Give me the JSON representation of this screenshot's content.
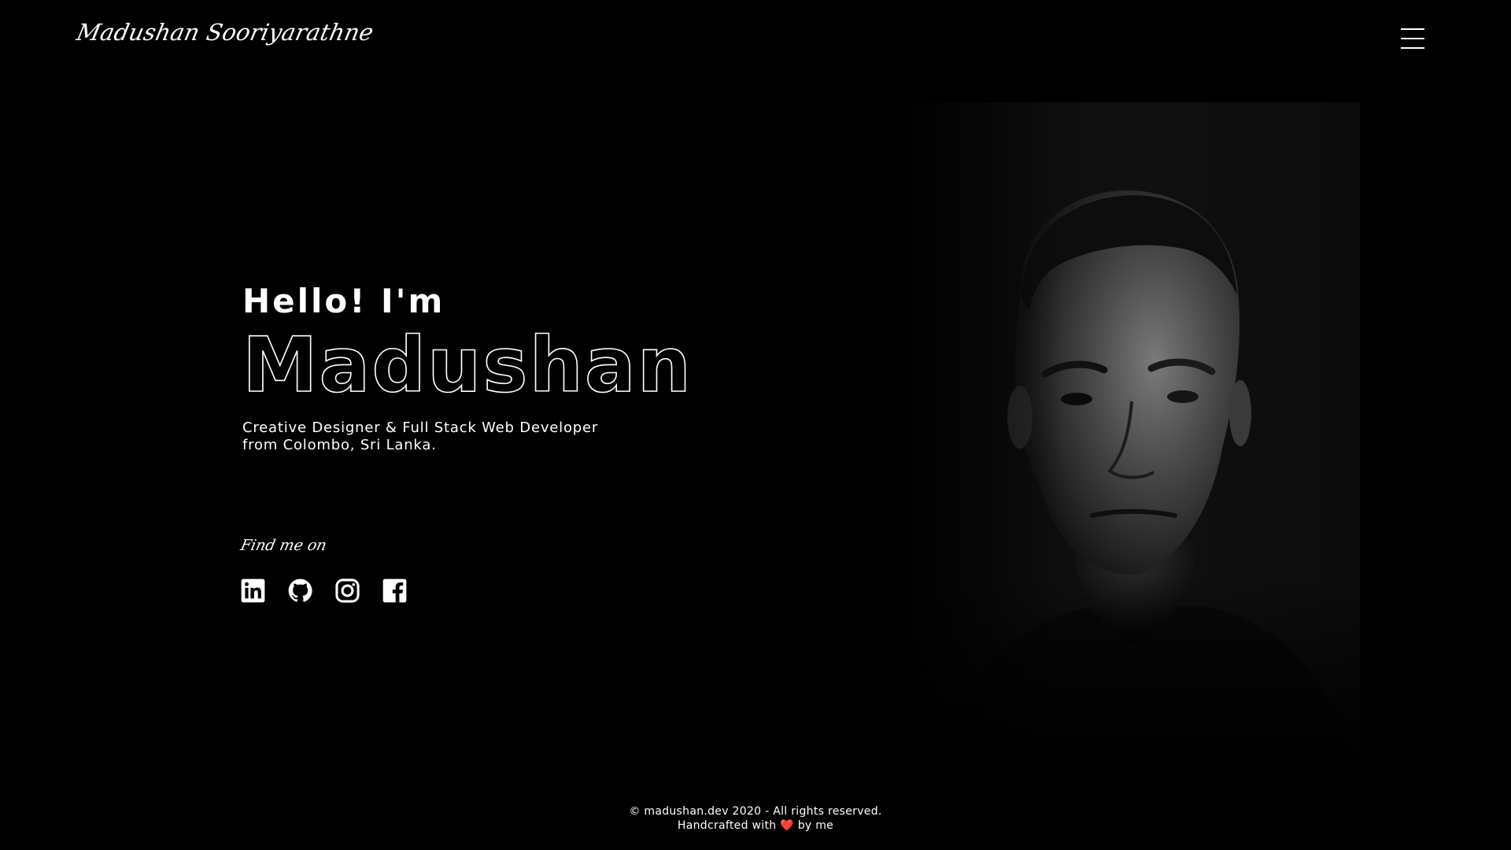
{
  "header": {
    "brand": "Madushan Sooriyarathne",
    "menu_icon": "hamburger-menu-icon"
  },
  "hero": {
    "greeting": "Hello! I'm",
    "name": "Madushan",
    "tagline_line1": "Creative Designer & Full Stack Web Developer",
    "tagline_line2": "from Colombo, Sri Lanka."
  },
  "social": {
    "label": "Find me on",
    "links": [
      {
        "name": "LinkedIn",
        "icon": "linkedin-icon"
      },
      {
        "name": "GitHub",
        "icon": "github-icon"
      },
      {
        "name": "Instagram",
        "icon": "instagram-icon"
      },
      {
        "name": "Facebook",
        "icon": "facebook-icon"
      }
    ]
  },
  "portrait": {
    "image": "portrait-photo"
  },
  "footer": {
    "copyright": "© madushan.dev 2020 - All rights reserved.",
    "credit_prefix": "Handcrafted with",
    "credit_heart": "❤️",
    "credit_suffix": "by me"
  },
  "colors": {
    "background": "#000000",
    "text": "#ffffff",
    "heart": "#e53935"
  }
}
